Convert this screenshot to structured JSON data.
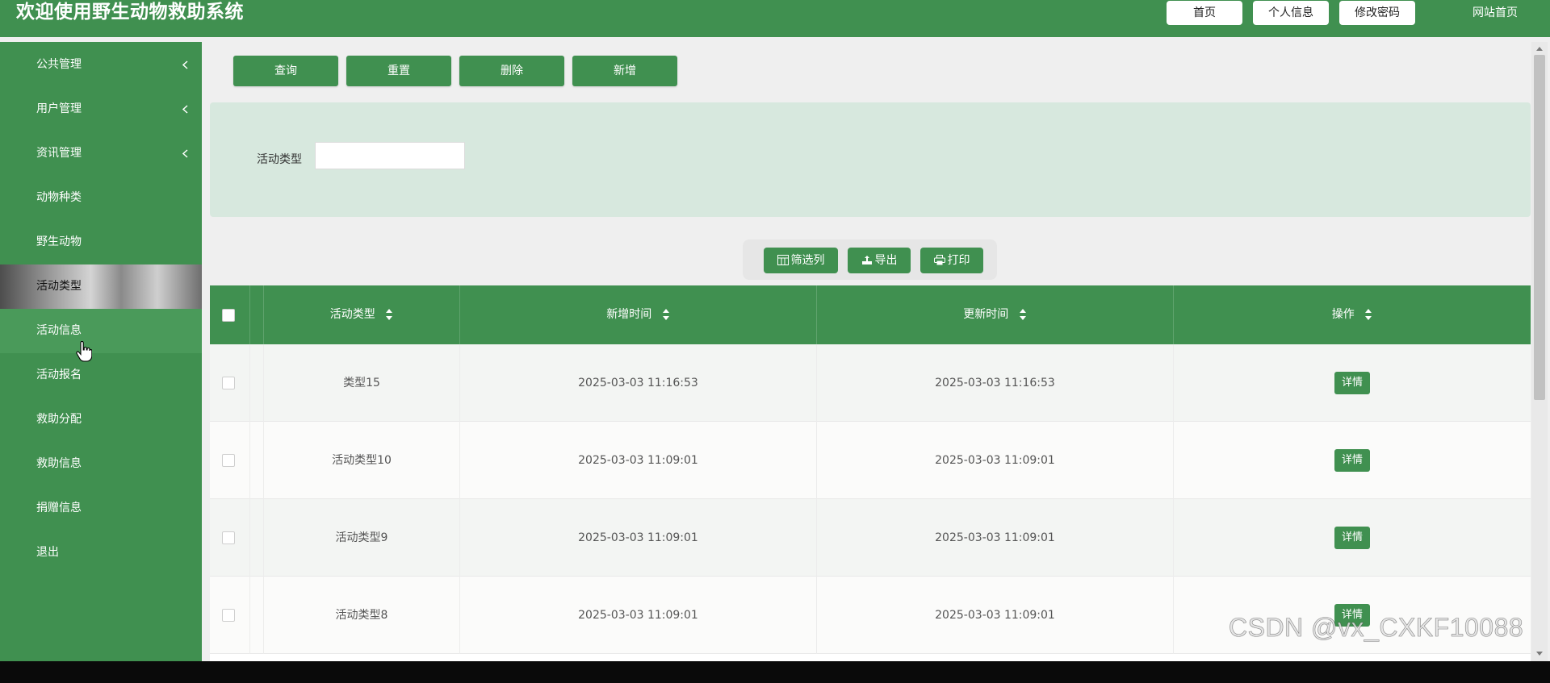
{
  "header": {
    "title": "欢迎使用野生动物救助系统",
    "buttons": [
      "首页",
      "个人信息",
      "修改密码"
    ],
    "site_link": "网站首页"
  },
  "sidebar": {
    "items": [
      {
        "label": "公共管理",
        "has_submenu": true
      },
      {
        "label": "用户管理",
        "has_submenu": true
      },
      {
        "label": "资讯管理",
        "has_submenu": true
      },
      {
        "label": "动物种类",
        "has_submenu": false
      },
      {
        "label": "野生动物",
        "has_submenu": false
      },
      {
        "label": "活动类型",
        "has_submenu": false,
        "active": true
      },
      {
        "label": "活动信息",
        "has_submenu": false,
        "hovered": true
      },
      {
        "label": "活动报名",
        "has_submenu": false
      },
      {
        "label": "救助分配",
        "has_submenu": false
      },
      {
        "label": "救助信息",
        "has_submenu": false
      },
      {
        "label": "捐赠信息",
        "has_submenu": false
      },
      {
        "label": "退出",
        "has_submenu": false
      }
    ]
  },
  "actions": {
    "query": "查询",
    "reset": "重置",
    "delete": "删除",
    "add": "新增"
  },
  "search": {
    "label": "活动类型",
    "value": "",
    "placeholder": ""
  },
  "toolbar": {
    "filter_columns": "筛选列",
    "export": "导出",
    "print": "打印"
  },
  "table": {
    "columns": [
      "活动类型",
      "新增时间",
      "更新时间",
      "操作"
    ],
    "detail_label": "详情",
    "rows": [
      {
        "type": "类型15",
        "created": "2025-03-03 11:16:53",
        "updated": "2025-03-03 11:16:53"
      },
      {
        "type": "活动类型10",
        "created": "2025-03-03 11:09:01",
        "updated": "2025-03-03 11:09:01"
      },
      {
        "type": "活动类型9",
        "created": "2025-03-03 11:09:01",
        "updated": "2025-03-03 11:09:01"
      },
      {
        "type": "活动类型8",
        "created": "2025-03-03 11:09:01",
        "updated": "2025-03-03 11:09:01"
      }
    ]
  },
  "watermark": "CSDN @vx_CXKF10088",
  "colors": {
    "primary": "#409050",
    "search_panel": "#d7e8de",
    "page_bg": "#efefef"
  }
}
